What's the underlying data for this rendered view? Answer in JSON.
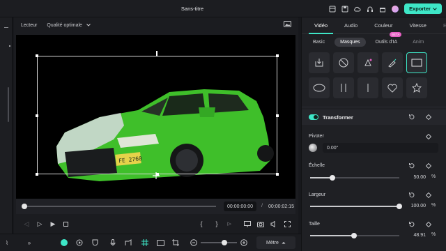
{
  "app": {
    "title": "Sans-titre",
    "export_label": "Exporter"
  },
  "player": {
    "label": "Lecteur",
    "quality": "Qualité optimale",
    "current_time": "00:00:00:00",
    "separator": "/",
    "total_time": "00:00:02:15",
    "plate_text": "FE 2760",
    "progress_fraction": 0.0
  },
  "panel": {
    "tabs": [
      {
        "label": "Vidéo",
        "active": true
      },
      {
        "label": "Audio",
        "active": false
      },
      {
        "label": "Couleur",
        "active": false
      },
      {
        "label": "Vitesse",
        "active": false
      },
      {
        "label": "Ef",
        "active": false
      }
    ],
    "subtabs": [
      {
        "label": "Basic",
        "active": false
      },
      {
        "label": "Masques",
        "active": true
      },
      {
        "label": "Outils d'IA",
        "active": false
      },
      {
        "label": "Anim",
        "active": false
      }
    ],
    "beta_badge": "BETA",
    "mask_shapes": [
      "import-mask-icon",
      "no-mask-icon",
      "pen-mask-icon",
      "brush-mask-icon",
      "rectangle-mask-icon",
      "ellipse-mask-icon",
      "double-line-mask-icon",
      "single-line-mask-icon",
      "heart-mask-icon",
      "star-mask-icon"
    ],
    "section_title": "Transformer",
    "rotate": {
      "label": "Pivoter",
      "value": "0.00°"
    },
    "scale": {
      "label": "Échelle",
      "value": "50.00",
      "unit": "%",
      "fraction": 0.25
    },
    "width": {
      "label": "Largeur",
      "value": "100.00",
      "unit": "%",
      "fraction": 1.0
    },
    "size": {
      "label": "Taille",
      "value": "48.91",
      "unit": "%",
      "fraction": 0.49
    }
  },
  "bottom": {
    "unit_label": "Mètre"
  },
  "colors": {
    "accent": "#3ee6c7",
    "beta": "#e860c4",
    "car": "#3fbf2a"
  }
}
